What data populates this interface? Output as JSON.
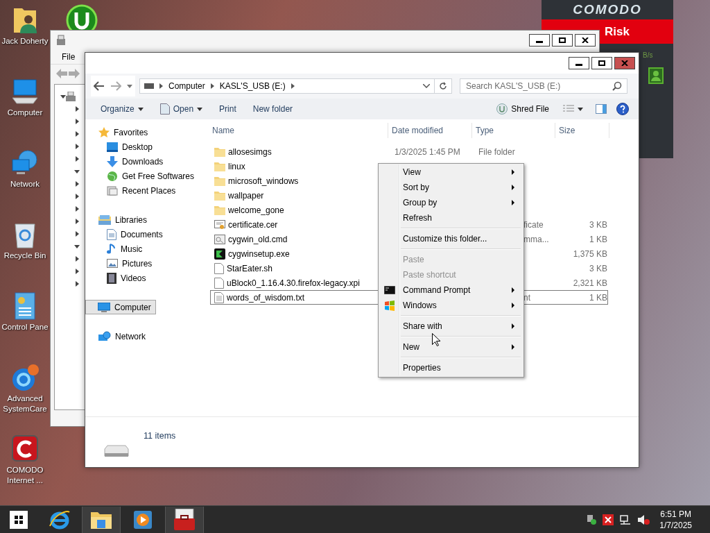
{
  "desktop_icons": [
    {
      "label": "Jack Doherty",
      "kind": "user"
    },
    {
      "label": "Computer",
      "kind": "computer"
    },
    {
      "label": "Network",
      "kind": "network"
    },
    {
      "label": "Recycle Bin",
      "kind": "recycle"
    },
    {
      "label": "Control Pane",
      "kind": "control"
    },
    {
      "label": "Advanced SystemCare",
      "kind": "care"
    },
    {
      "label": "COMODO Internet ...",
      "kind": "comodo"
    }
  ],
  "comodo_widget": {
    "brand": "COMODO",
    "status": "Risk",
    "speed": "B/s"
  },
  "back_window": {
    "menu": [
      "File"
    ],
    "tree_arrows": [
      {
        "expanded": false
      },
      {
        "expanded": false
      },
      {
        "expanded": false
      },
      {
        "expanded": false
      },
      {
        "expanded": false
      },
      {
        "expanded": true
      },
      {
        "expanded": false
      },
      {
        "expanded": false
      },
      {
        "expanded": false
      },
      {
        "expanded": false
      },
      {
        "expanded": false
      },
      {
        "expanded": true
      },
      {
        "expanded": false
      },
      {
        "expanded": false
      },
      {
        "expanded": false
      }
    ]
  },
  "explorer": {
    "breadcrumb": [
      "Computer",
      "KASL'S_USB (E:)"
    ],
    "search": {
      "placeholder": "Search KASL'S_USB (E:)"
    },
    "toolbar": [
      {
        "label": "Organize",
        "dropdown": true,
        "kind": "text"
      },
      {
        "label": "Open",
        "dropdown": true,
        "kind": "open"
      },
      {
        "label": "Print",
        "dropdown": false,
        "kind": "text"
      },
      {
        "label": "New folder",
        "dropdown": false,
        "kind": "text"
      }
    ],
    "shred": "Shred File",
    "nav": [
      {
        "label": "Favorites",
        "kind": "star",
        "selected": false,
        "children": [
          {
            "label": "Desktop",
            "kind": "desktop",
            "selected": false
          },
          {
            "label": "Downloads",
            "kind": "download",
            "selected": false
          },
          {
            "label": "Get Free Softwares",
            "kind": "globe",
            "selected": false
          },
          {
            "label": "Recent Places",
            "kind": "recent",
            "selected": false
          }
        ]
      },
      {
        "label": "Libraries",
        "kind": "library",
        "selected": false,
        "children": [
          {
            "label": "Documents",
            "kind": "document",
            "selected": false
          },
          {
            "label": "Music",
            "kind": "music",
            "selected": false
          },
          {
            "label": "Pictures",
            "kind": "pictures",
            "selected": false
          },
          {
            "label": "Videos",
            "kind": "videos",
            "selected": false
          }
        ]
      },
      {
        "label": "Computer",
        "kind": "computer",
        "selected": true
      },
      {
        "label": "Network",
        "kind": "network",
        "selected": false
      }
    ],
    "columns": [
      "Name",
      "Date modified",
      "Type",
      "Size"
    ],
    "rows": [
      {
        "name": "allosesimgs",
        "kind": "folder",
        "date": "1/3/2025 1:45 PM",
        "type": "File folder",
        "type_cut": false,
        "focused": false
      },
      {
        "name": "linux",
        "kind": "folder",
        "focused": false
      },
      {
        "name": "microsoft_windows",
        "kind": "folder",
        "focused": false
      },
      {
        "name": "wallpaper",
        "kind": "folder",
        "focused": false
      },
      {
        "name": "welcome_gone",
        "kind": "folder",
        "focused": false
      },
      {
        "name": "certificate.cer",
        "kind": "cert",
        "type": "ficate",
        "type_cut": true,
        "size": "3 KB",
        "focused": false
      },
      {
        "name": "cygwin_old.cmd",
        "kind": "cmd",
        "type": "mma...",
        "type_cut": true,
        "size": "1 KB",
        "focused": false
      },
      {
        "name": "cygwinsetup.exe",
        "kind": "exe",
        "size": "1,375 KB",
        "focused": false
      },
      {
        "name": "StarEater.sh",
        "kind": "file",
        "size": "3 KB",
        "focused": false
      },
      {
        "name": "uBlock0_1.16.4.30.firefox-legacy.xpi",
        "kind": "file",
        "size": "2,321 KB",
        "focused": false
      },
      {
        "name": "words_of_wisdom.txt",
        "kind": "text",
        "type": "nt",
        "type_cut": true,
        "size": "1 KB",
        "focused": true
      }
    ],
    "status": "11 items"
  },
  "context_menu": {
    "groups": [
      [
        {
          "label": "View",
          "submenu": true,
          "disabled": false
        },
        {
          "label": "Sort by",
          "submenu": true,
          "disabled": false
        },
        {
          "label": "Group by",
          "submenu": true,
          "disabled": false
        },
        {
          "label": "Refresh",
          "submenu": false,
          "disabled": false
        }
      ],
      [
        {
          "label": "Customize this folder...",
          "submenu": false,
          "disabled": false
        }
      ],
      [
        {
          "label": "Paste",
          "submenu": false,
          "disabled": true
        },
        {
          "label": "Paste shortcut",
          "submenu": false,
          "disabled": true
        },
        {
          "label": "Command Prompt",
          "submenu": true,
          "disabled": false,
          "kind": "terminal"
        },
        {
          "label": "Windows",
          "submenu": true,
          "disabled": false,
          "kind": "flag"
        }
      ],
      [
        {
          "label": "Share with",
          "submenu": true,
          "disabled": false
        }
      ],
      [
        {
          "label": "New",
          "submenu": true,
          "disabled": false
        }
      ],
      [
        {
          "label": "Properties",
          "submenu": false,
          "disabled": false
        }
      ]
    ]
  },
  "taskbar": {
    "apps": [
      {
        "kind": "ie",
        "active": false
      },
      {
        "kind": "explorer",
        "active": true
      },
      {
        "kind": "media",
        "active": false
      },
      {
        "kind": "toolbox",
        "active": true
      }
    ],
    "time": "6:51 PM",
    "date": "1/7/2025"
  }
}
